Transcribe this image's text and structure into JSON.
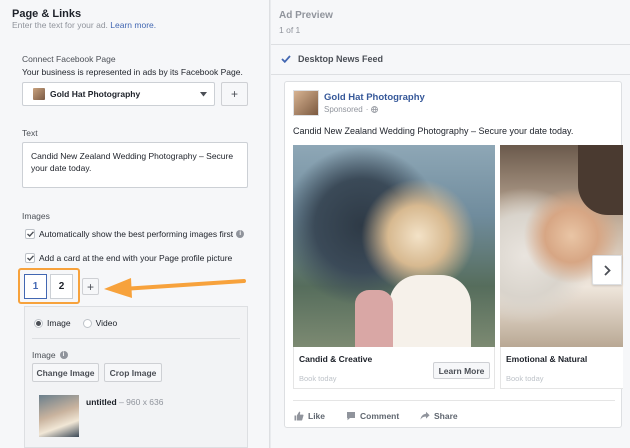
{
  "left": {
    "title": "Page & Links",
    "subtitle": "Enter the text for your ad.",
    "learn_more": "Learn more.",
    "connect_label": "Connect Facebook Page",
    "connect_desc": "Your business is represented in ads by its Facebook Page.",
    "page_select": "Gold Hat Photography",
    "add_symbol": "+",
    "text_label": "Text",
    "text_value": "Candid New Zealand Wedding Photography – Secure your date today.",
    "images_label": "Images",
    "auto_show": "Automatically show the best performing images first",
    "add_card": "Add a card at the end with your Page profile picture",
    "card_tabs": [
      "1",
      "2"
    ],
    "card_add": "+",
    "media_image": "Image",
    "media_video": "Video",
    "image_label": "Image",
    "change_image": "Change Image",
    "crop_image": "Crop Image",
    "file_name": "untitled",
    "file_dims": " – 960 x 636"
  },
  "right": {
    "title": "Ad Preview",
    "pager": "1 of 1",
    "feed": "Desktop News Feed",
    "page_name": "Gold Hat Photography",
    "sponsored": "Sponsored",
    "dot": "·",
    "post_text": "Candid New Zealand Wedding Photography – Secure your date today.",
    "cards": [
      {
        "headline": "Candid & Creative",
        "link_desc": "Book today",
        "cta": "Learn More"
      },
      {
        "headline": "Emotional & Natural",
        "link_desc": "Book today"
      }
    ],
    "actions": {
      "like": "Like",
      "comment": "Comment",
      "share": "Share"
    }
  },
  "colors": {
    "link": "#4267b2",
    "highlight": "#f7a23c",
    "panel": "#f6f7f9"
  },
  "icons": [
    "check-icon",
    "info-icon",
    "globe-icon",
    "chevron-down-icon",
    "chevron-right-icon",
    "arrow-left-icon",
    "like-icon",
    "comment-icon",
    "share-icon"
  ]
}
